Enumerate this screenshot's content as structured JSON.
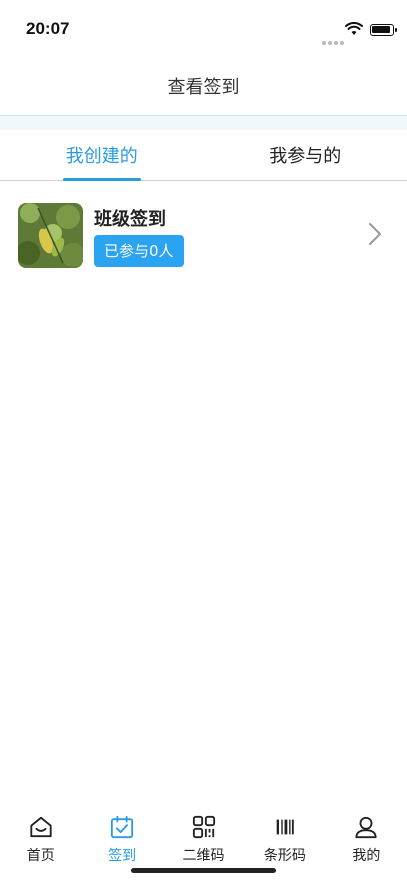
{
  "status": {
    "time": "20:07"
  },
  "nav": {
    "title": "查看签到"
  },
  "tabs": [
    {
      "label": "我创建的",
      "active": true
    },
    {
      "label": "我参与的",
      "active": false
    }
  ],
  "items": [
    {
      "title": "班级签到",
      "badge": "已参与0人",
      "thumbnail": "leaf-photo"
    }
  ],
  "tabbar": [
    {
      "label": "首页",
      "icon": "home-icon",
      "active": false
    },
    {
      "label": "签到",
      "icon": "calendar-check-icon",
      "active": true
    },
    {
      "label": "二维码",
      "icon": "qrcode-icon",
      "active": false
    },
    {
      "label": "条形码",
      "icon": "barcode-icon",
      "active": false
    },
    {
      "label": "我的",
      "icon": "user-icon",
      "active": false
    }
  ],
  "colors": {
    "accent": "#2b9be0",
    "badge": "#2aa3f0"
  }
}
